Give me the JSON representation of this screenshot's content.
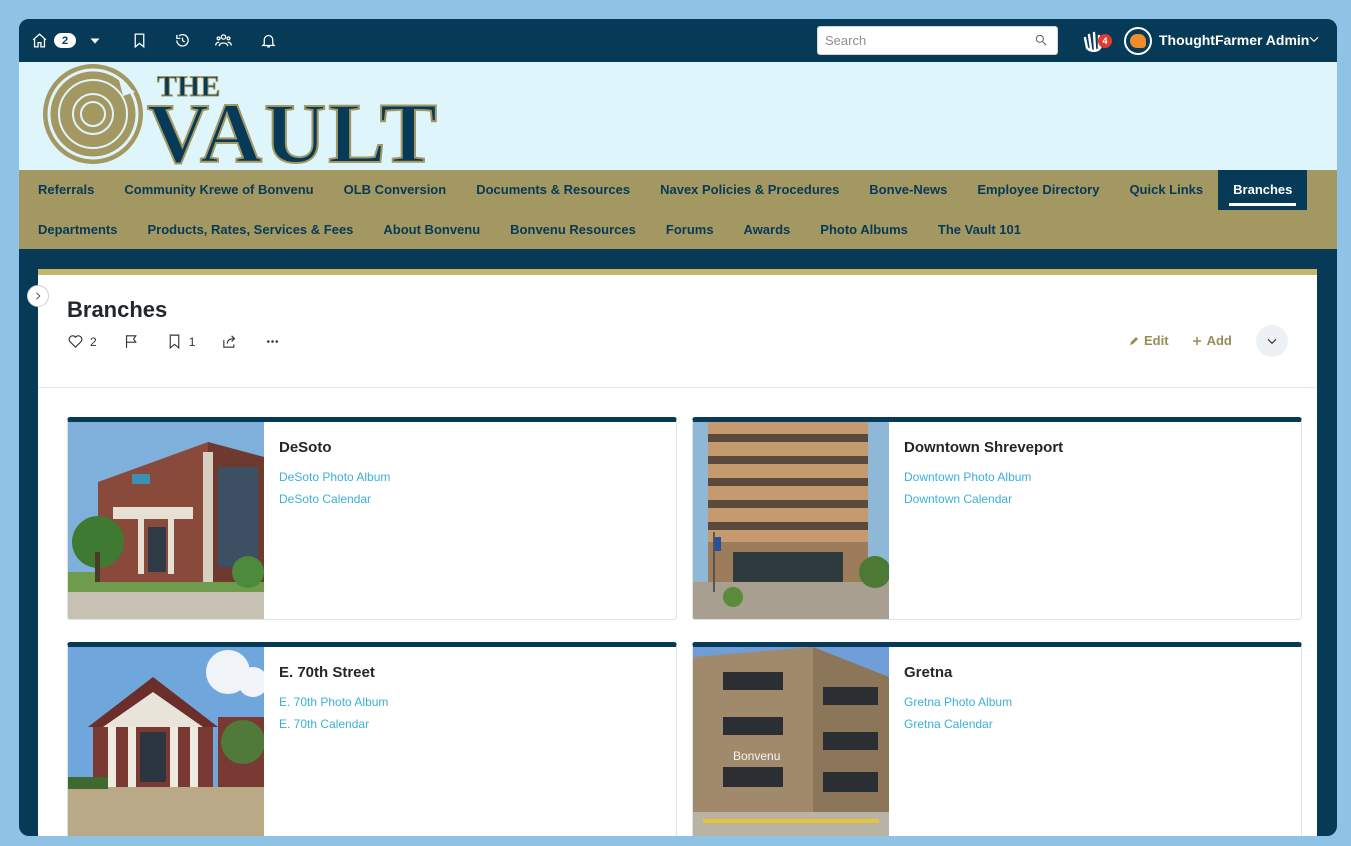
{
  "topbar": {
    "home_badge": "2",
    "search_placeholder": "Search",
    "wave_badge": "4",
    "user_name": "ThoughtFarmer Admin"
  },
  "banner": {
    "logo_small_text": "THE",
    "logo_big_text": "VAULT"
  },
  "nav": {
    "row1": [
      "Referrals",
      "Community Krewe of Bonvenu",
      "OLB Conversion",
      "Documents & Resources",
      "Navex Policies & Procedures",
      "Bonve-News",
      "Employee Directory",
      "Quick Links",
      "Branches"
    ],
    "row2": [
      "Departments",
      "Products, Rates, Services & Fees",
      "About Bonvenu",
      "Bonvenu Resources",
      "Forums",
      "Awards",
      "Photo Albums",
      "The Vault 101"
    ],
    "active": "Branches"
  },
  "page": {
    "title": "Branches",
    "likes": "2",
    "bookmarks": "1",
    "edit_label": "Edit",
    "add_label": "Add"
  },
  "cards": [
    {
      "title": "DeSoto",
      "album": "DeSoto Photo Album",
      "calendar": "DeSoto Calendar"
    },
    {
      "title": "Downtown Shreveport",
      "album": "Downtown Photo Album",
      "calendar": "Downtown Calendar"
    },
    {
      "title": "E. 70th Street",
      "album": "E. 70th Photo Album",
      "calendar": "E. 70th Calendar"
    },
    {
      "title": "Gretna",
      "album": "Gretna Photo Album",
      "calendar": "Gretna Calendar",
      "sign": "Bonvenu"
    }
  ],
  "colors": {
    "navy": "#063a56",
    "gold": "#a39762",
    "banner": "#dff5fc",
    "link": "#3ab0d8",
    "badge_red": "#e03b2c"
  }
}
